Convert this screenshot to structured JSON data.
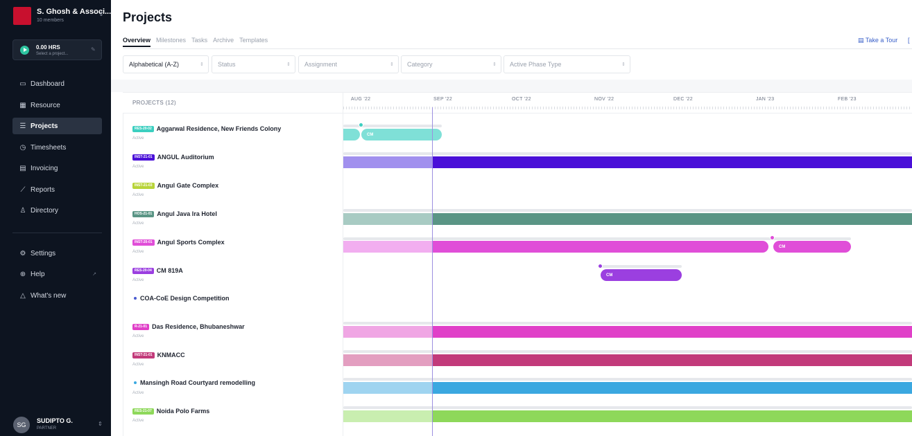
{
  "org": {
    "name": "S. Ghosh & Associ...",
    "members": "10 members"
  },
  "timer": {
    "hours": "0.00 HRS",
    "hint": "Select a project..."
  },
  "nav": [
    {
      "label": "Dashboard",
      "icon": "monitor-icon"
    },
    {
      "label": "Resource",
      "icon": "calendar-icon"
    },
    {
      "label": "Projects",
      "icon": "projects-icon",
      "active": true
    },
    {
      "label": "Timesheets",
      "icon": "clock-icon"
    },
    {
      "label": "Invoicing",
      "icon": "invoice-icon"
    },
    {
      "label": "Reports",
      "icon": "chart-icon"
    },
    {
      "label": "Directory",
      "icon": "person-icon"
    }
  ],
  "nav_bottom": [
    {
      "label": "Settings",
      "icon": "gear-icon"
    },
    {
      "label": "Help",
      "icon": "lifebuoy-icon"
    },
    {
      "label": "What's new",
      "icon": "bell-icon"
    }
  ],
  "user": {
    "initials": "SG",
    "name": "SUDIPTO G.",
    "role": "PARTNER"
  },
  "page": {
    "title": "Projects"
  },
  "tabs": [
    "Overview",
    "Milestones",
    "Tasks",
    "Archive",
    "Templates"
  ],
  "tour": "Take a Tour",
  "filters": {
    "sort": "Alphabetical (A-Z)",
    "status": "Status",
    "assignment": "Assignment",
    "category": "Category",
    "phase": "Active Phase Type"
  },
  "table": {
    "projects_header": "PROJECTS (12)",
    "months": [
      "AUG '22",
      "SEP '22",
      "OCT '22",
      "NOV '22",
      "DEC '22",
      "JAN '23",
      "FEB '23"
    ]
  },
  "projects": [
    {
      "code": "RES-20-02",
      "name": "Aggarwal Residence, New Friends Colony",
      "status": "Active",
      "color": "#3ccfc0"
    },
    {
      "code": "INST-21-01",
      "name": "ANGUL Auditorium",
      "status": "Active",
      "color": "#4a10d8"
    },
    {
      "code": "INST-21-03",
      "name": "Angul Gate Complex",
      "status": "Active",
      "color": "#b8d43a"
    },
    {
      "code": "HOS-21-01",
      "name": "Angul Java Ira Hotel",
      "status": "Active",
      "color": "#5a9585"
    },
    {
      "code": "INST-20-01",
      "name": "Angul Sports Complex",
      "status": "Active",
      "color": "#e04ed8"
    },
    {
      "code": "RES-20-04",
      "name": "CM 819A",
      "status": "Active",
      "color": "#9b3fe0"
    },
    {
      "code": "",
      "name": "COA-CoE Design Competition",
      "status": "",
      "color": "#4a5bd0"
    },
    {
      "code": "R-21-01",
      "name": "Das Residence, Bhubaneshwar",
      "status": "Active",
      "color": "#e040c8"
    },
    {
      "code": "INST-21-01",
      "name": "KNMACC",
      "status": "Active",
      "color": "#c23a7a"
    },
    {
      "code": "",
      "name": "Mansingh Road Courtyard remodelling",
      "status": "Active",
      "color": "#3ba8e0"
    },
    {
      "code": "RES-21-07",
      "name": "Noida Polo Farms",
      "status": "Active",
      "color": "#8ed85a"
    }
  ],
  "phase_labels": {
    "cm": "CM"
  }
}
